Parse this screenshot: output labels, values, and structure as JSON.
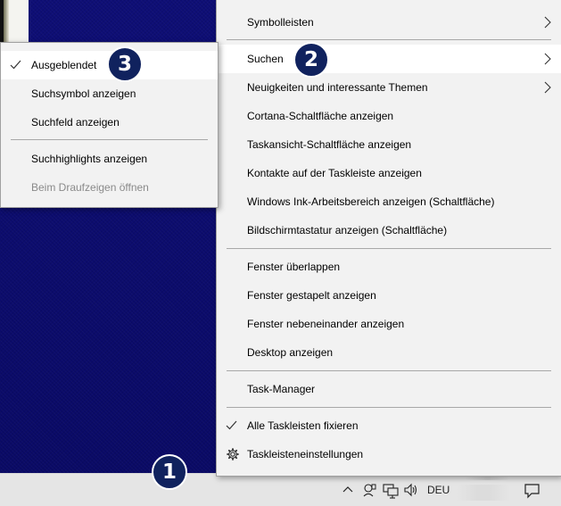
{
  "main_menu": {
    "items": [
      {
        "label": "Symbolleisten",
        "submenu": true
      },
      {
        "label": "Suchen",
        "submenu": true,
        "highlighted": true
      },
      {
        "label": "Neuigkeiten und interessante Themen",
        "submenu": true
      },
      {
        "label": "Cortana-Schaltfläche anzeigen"
      },
      {
        "label": "Taskansicht-Schaltfläche anzeigen"
      },
      {
        "label": "Kontakte auf der Taskleiste anzeigen"
      },
      {
        "label": "Windows Ink-Arbeitsbereich anzeigen (Schaltfläche)"
      },
      {
        "label": "Bildschirmtastatur anzeigen (Schaltfläche)"
      },
      {
        "label": "Fenster überlappen"
      },
      {
        "label": "Fenster gestapelt anzeigen"
      },
      {
        "label": "Fenster nebeneinander anzeigen"
      },
      {
        "label": "Desktop anzeigen"
      },
      {
        "label": "Task-Manager"
      },
      {
        "label": "Alle Taskleisten fixieren",
        "checked": true
      },
      {
        "label": "Taskleisteneinstellungen",
        "icon": "gear-icon"
      }
    ]
  },
  "sub_menu": {
    "items": [
      {
        "label": "Ausgeblendet",
        "checked": true,
        "highlighted": true
      },
      {
        "label": "Suchsymbol anzeigen"
      },
      {
        "label": "Suchfeld anzeigen"
      },
      {
        "label": "Suchhighlights anzeigen"
      },
      {
        "label": "Beim Draufzeigen öffnen",
        "disabled": true
      }
    ]
  },
  "badges": {
    "one": "1",
    "two": "2",
    "three": "3"
  },
  "taskbar": {
    "language": "DEU",
    "tray_icons": [
      "chevron-up-icon",
      "meet-now-icon",
      "network-icon",
      "volume-icon",
      "notification-icon"
    ]
  },
  "colors": {
    "menu_bg": "#f2f2f2",
    "menu_hover": "#ffffff",
    "badge_bg": "#10225e",
    "desktop_bg": "#0b0b6b",
    "taskbar_bg": "#e5e5e5"
  }
}
